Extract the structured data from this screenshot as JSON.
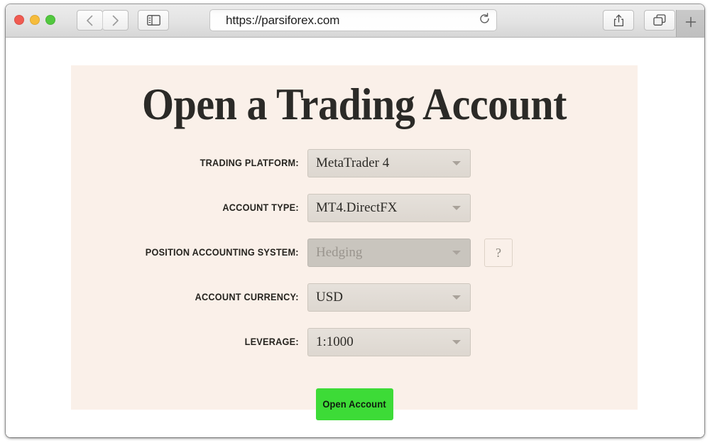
{
  "browser": {
    "url": "https://parsiforex.com",
    "traffic_lights": [
      "close",
      "minimize",
      "maximize"
    ],
    "back_icon": "chevron-left-icon",
    "forward_icon": "chevron-right-icon",
    "sidebar_icon": "sidebar-icon",
    "reload_icon": "reload-icon",
    "share_icon": "share-icon",
    "tabs_icon": "tabs-icon",
    "new_tab_label": "+"
  },
  "page": {
    "title": "Open a Trading Account",
    "form": {
      "rows": [
        {
          "label": "TRADING PLATFORM:",
          "value": "MetaTrader 4",
          "disabled": false,
          "help": false
        },
        {
          "label": "ACCOUNT TYPE:",
          "value": "MT4.DirectFX",
          "disabled": false,
          "help": false
        },
        {
          "label": "POSITION ACCOUNTING SYSTEM:",
          "value": "Hedging",
          "disabled": true,
          "help": true
        },
        {
          "label": "ACCOUNT CURRENCY:",
          "value": "USD",
          "disabled": false,
          "help": false
        },
        {
          "label": "LEVERAGE:",
          "value": "1:1000",
          "disabled": false,
          "help": false
        }
      ],
      "help_label": "?",
      "submit_label": "Open Account"
    }
  },
  "colors": {
    "card_background": "#faf0e9",
    "select_background": "#e0dbd5",
    "select_disabled_background": "#c9c5be",
    "submit_green": "#3ddb37",
    "text_dark": "#2b2a27"
  }
}
